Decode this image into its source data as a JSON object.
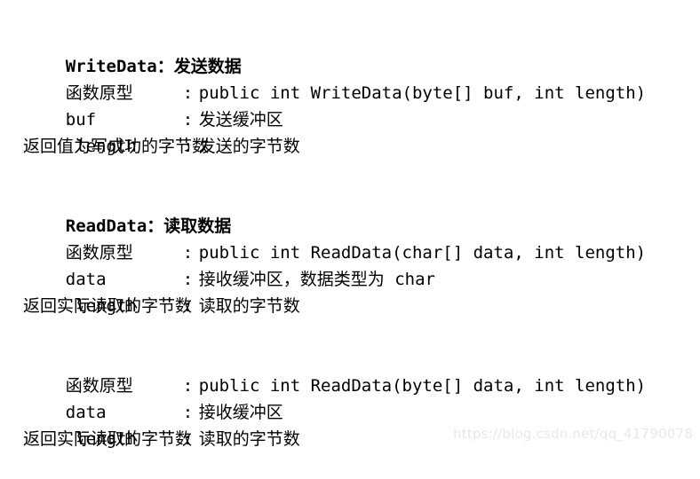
{
  "document": {
    "sections": [
      {
        "heading": {
          "name": "WriteData",
          "separator": "：",
          "description": "发送数据"
        },
        "rows": [
          {
            "label": "函数原型",
            "separator": ":",
            "value": "public int WriteData(byte[] buf, int length)"
          },
          {
            "label": "buf",
            "separator": ":",
            "value": "发送缓冲区"
          },
          {
            "label": " length",
            "separator": ":",
            "value": "发送的字节数"
          }
        ],
        "note": "返回值为写成功的字节数"
      },
      {
        "heading": {
          "name": "ReadData",
          "separator": "：",
          "description": "读取数据"
        },
        "rows": [
          {
            "label": "函数原型",
            "separator": ":",
            "value": "public int ReadData(char[] data, int length)"
          },
          {
            "label": "data",
            "separator": ":",
            "value": "接收缓冲区，数据类型为 char"
          },
          {
            "label": " length",
            "separator": ":",
            "value": "读取的字节数"
          }
        ],
        "note": "返回实际读取的字节数"
      },
      {
        "heading": null,
        "rows": [
          {
            "label": "函数原型",
            "separator": ":",
            "value": "public int ReadData(byte[] data, int length)"
          },
          {
            "label": "data",
            "separator": ":",
            "value": "接收缓冲区"
          },
          {
            "label": " length",
            "separator": ":",
            "value": "读取的字节数"
          }
        ],
        "note": "返回实际读取的字节数"
      }
    ]
  },
  "watermark": {
    "text": "https://blog.csdn.net/qq_41790078",
    "color": "#e8e8e8"
  },
  "colors": {
    "background": "#ffffff",
    "text": "#000000"
  }
}
